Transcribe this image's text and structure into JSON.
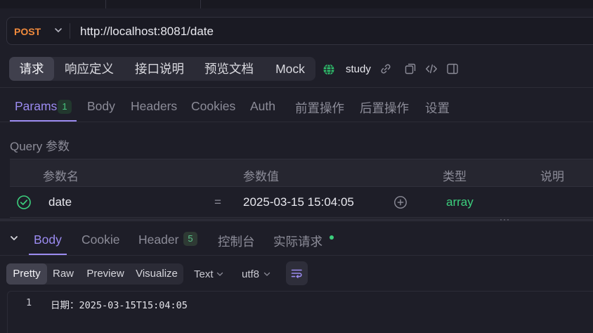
{
  "request": {
    "method": "POST",
    "url": "http://localhost:8081/date"
  },
  "top_tabs": [
    {
      "label": "请求",
      "active": true
    },
    {
      "label": "响应定义",
      "active": false
    },
    {
      "label": "接口说明",
      "active": false
    },
    {
      "label": "预览文档",
      "active": false
    },
    {
      "label": "Mock",
      "active": false
    }
  ],
  "environment": {
    "name": "study",
    "icon": "globe-icon"
  },
  "toolbar_icons": [
    "link-icon",
    "copy-icon",
    "code-icon",
    "panel-icon"
  ],
  "request_tabs": [
    {
      "label": "Params",
      "badge": "1",
      "active": true
    },
    {
      "label": "Body"
    },
    {
      "label": "Headers"
    },
    {
      "label": "Cookies"
    },
    {
      "label": "Auth"
    },
    {
      "label": "前置操作"
    },
    {
      "label": "后置操作"
    },
    {
      "label": "设置"
    }
  ],
  "query": {
    "section_label": "Query 参数",
    "columns": [
      "参数名",
      "参数值",
      "类型",
      "说明"
    ],
    "rows": [
      {
        "enabled": true,
        "name": "date",
        "operator": "=",
        "value": "2025-03-15 15:04:05",
        "type": "array",
        "description": ""
      }
    ]
  },
  "splitter_handle": "···",
  "response_tabs": [
    {
      "label": "Body",
      "active": true
    },
    {
      "label": "Cookie"
    },
    {
      "label": "Header",
      "badge": "5"
    },
    {
      "label": "控制台"
    },
    {
      "label": "实际请求"
    }
  ],
  "view_modes": [
    {
      "label": "Pretty",
      "active": true
    },
    {
      "label": "Raw"
    },
    {
      "label": "Preview"
    },
    {
      "label": "Visualize"
    }
  ],
  "format_select": "Text",
  "encoding_select": "utf8",
  "response_body": {
    "line_number": "1",
    "text": "日期：2025-03-15T15:04:05"
  },
  "colors": {
    "accent": "#9b8bf0",
    "method": "#f08a3c",
    "success": "#3ccf7d",
    "type_text": "#3ccf7d"
  }
}
